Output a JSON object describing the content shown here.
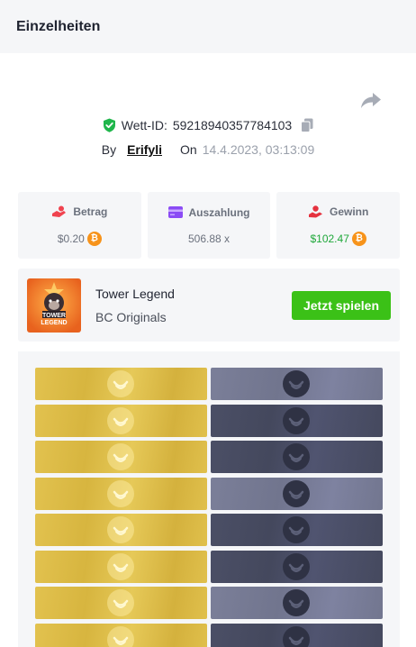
{
  "header": {
    "title": "Einzelheiten"
  },
  "bet": {
    "id_label": "Wett-ID:",
    "id_value": "59218940357784103",
    "by_label": "By",
    "user": "Erifyli",
    "on_label": "On",
    "timestamp": "14.4.2023, 03:13:09"
  },
  "stats": {
    "amount": {
      "label": "Betrag",
      "value": "$0.20",
      "icon": "bet-hand-icon"
    },
    "payout": {
      "label": "Auszahlung",
      "value": "506.88 x",
      "icon": "card-icon"
    },
    "profit": {
      "label": "Gewinn",
      "value": "$102.47",
      "icon": "profit-hand-icon"
    }
  },
  "colors": {
    "accent_green": "#3bc117",
    "profit_green": "#1fa83a",
    "btc_orange": "#f7931a",
    "tile_gold": "#ddbc47",
    "tile_dark": "#4a4e64",
    "tile_light": "#777b95"
  },
  "game": {
    "name": "Tower Legend",
    "provider": "BC Originals",
    "play_label": "Jetzt spielen",
    "thumb_text": [
      "TOWER",
      "LEGEND"
    ]
  },
  "board": {
    "rows": [
      [
        "gold",
        "light"
      ],
      [
        "gold",
        "dark"
      ],
      [
        "gold",
        "dark"
      ],
      [
        "gold",
        "light"
      ],
      [
        "gold",
        "dark"
      ],
      [
        "gold",
        "dark"
      ],
      [
        "gold",
        "light"
      ],
      [
        "gold",
        "dark"
      ]
    ]
  }
}
